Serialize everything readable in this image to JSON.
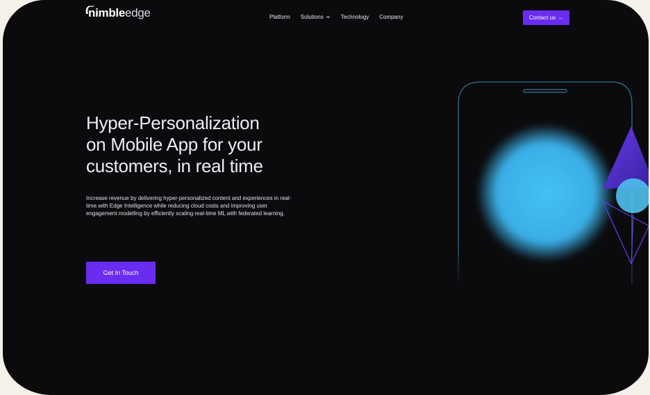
{
  "brand": {
    "name_bold": "nimble",
    "name_light": "edge"
  },
  "nav": {
    "items": [
      {
        "label": "Platform",
        "has_dropdown": false
      },
      {
        "label": "Solutions",
        "has_dropdown": true
      },
      {
        "label": "Technology",
        "has_dropdown": false
      },
      {
        "label": "Company",
        "has_dropdown": false
      }
    ],
    "contact_label": "Contact us",
    "contact_arrow": "→"
  },
  "hero": {
    "title_lines": [
      "Hyper-Personalization",
      "on Mobile App for your",
      "customers, in real time"
    ],
    "description_lines": [
      "Increase revenue by delivering hyper-personalized content and experiences in real-",
      "time with Edge Intelligence while reducing cloud costs and improving user",
      "engagement modelling by efficiently scaling real-time ML with federated learning."
    ],
    "cta_label": "Get In Touch"
  },
  "colors": {
    "background": "#0b0b0d",
    "accent": "#6a2cf0",
    "sphere": "#3fb4ec",
    "phone_outline": "#2e6a8a",
    "prism": "#5b36d6"
  },
  "icons": {
    "logo": "cat-head-logo",
    "dropdown": "chevron-down-icon",
    "arrow": "arrow-right-icon"
  }
}
